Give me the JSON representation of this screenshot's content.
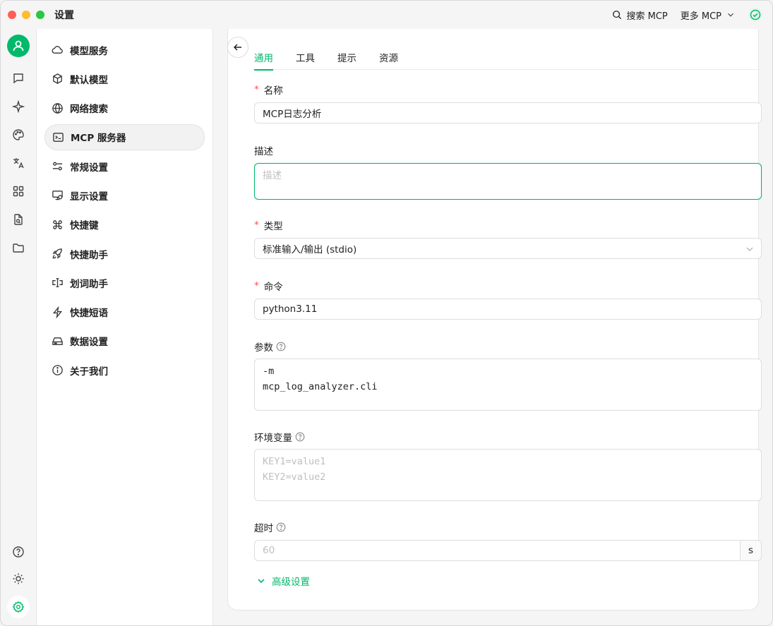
{
  "window": {
    "title": "设置"
  },
  "titlebar": {
    "search_mcp": "搜索 MCP",
    "more_mcp": "更多 MCP"
  },
  "nav": {
    "items": [
      {
        "label": "模型服务",
        "icon": "cloud-icon"
      },
      {
        "label": "默认模型",
        "icon": "cube-icon"
      },
      {
        "label": "网络搜索",
        "icon": "globe-icon"
      },
      {
        "label": "MCP 服务器",
        "icon": "terminal-icon",
        "active": true
      },
      {
        "label": "常规设置",
        "icon": "sliders-icon"
      },
      {
        "label": "显示设置",
        "icon": "monitor-icon"
      },
      {
        "label": "快捷键",
        "icon": "command-icon"
      },
      {
        "label": "快捷助手",
        "icon": "rocket-icon"
      },
      {
        "label": "划词助手",
        "icon": "text-select-icon"
      },
      {
        "label": "快捷短语",
        "icon": "zap-icon"
      },
      {
        "label": "数据设置",
        "icon": "hard-drive-icon"
      },
      {
        "label": "关于我们",
        "icon": "info-icon"
      }
    ]
  },
  "tabs": [
    "通用",
    "工具",
    "提示",
    "资源"
  ],
  "form": {
    "name_label": "名称",
    "name_value": "MCP日志分析",
    "desc_label": "描述",
    "desc_placeholder": "描述",
    "type_label": "类型",
    "type_value": "标准输入/输出 (stdio)",
    "command_label": "命令",
    "command_value": "python3.11",
    "args_label": "参数",
    "args_lines": [
      "-m",
      "mcp_log_analyzer.cli"
    ],
    "env_label": "环境变量",
    "env_placeholder_lines": [
      "KEY1=value1",
      "KEY2=value2"
    ],
    "timeout_label": "超时",
    "timeout_placeholder": "60",
    "timeout_suffix": "s",
    "advanced_label": "高级设置"
  },
  "colors": {
    "accent": "#00b96b",
    "required": "#ff4d4f"
  }
}
